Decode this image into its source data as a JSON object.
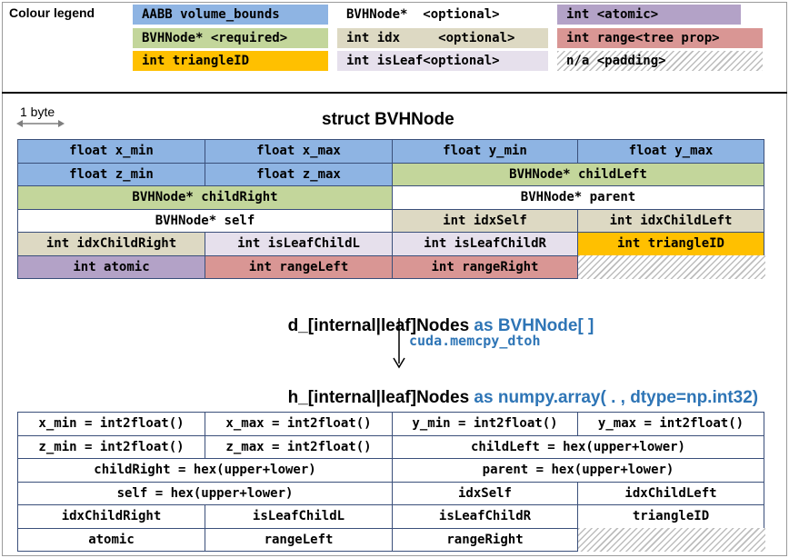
{
  "legend": {
    "title": "Colour legend",
    "items": [
      {
        "id": "aabb",
        "label": "AABB volume_bounds",
        "color": "#8eb4e3"
      },
      {
        "id": "bvh_opt",
        "label": "BVHNode*  <optional>",
        "color": "#ffffff"
      },
      {
        "id": "int_atomic",
        "label": "int <atomic>",
        "color": "#b3a2c7"
      },
      {
        "id": "bvh_req",
        "label": "BVHNode* <required>",
        "color": "#c3d69b"
      },
      {
        "id": "int_idx",
        "label": "int idx     <optional>",
        "color": "#ddd9c3"
      },
      {
        "id": "int_range",
        "label": "int range<tree prop>",
        "color": "#d99694"
      },
      {
        "id": "int_tri",
        "label": "int triangleID",
        "color": "#ffc000"
      },
      {
        "id": "int_isleaf",
        "label": "int isLeaf<optional>",
        "color": "#e6e0ec"
      },
      {
        "id": "na",
        "label": "n/a <padding>",
        "color": "hatch"
      }
    ]
  },
  "scale_label": "1 byte",
  "struct_title": "struct BVHNode",
  "device_label": {
    "prefix": "d_[internal|leaf]Nodes ",
    "suffix": "as BVHNode[ ]"
  },
  "memcpy_label": "cuda.memcpy_dtoh",
  "host_label": {
    "prefix": "h_[internal|leaf]Nodes ",
    "suffix": "as numpy.array( . , dtype=np.int32)"
  },
  "struct_cells": [
    {
      "text": "float x_min",
      "color": "#8eb4e3"
    },
    {
      "text": "float x_max",
      "color": "#8eb4e3"
    },
    {
      "text": "float y_min",
      "color": "#8eb4e3"
    },
    {
      "text": "float y_max",
      "color": "#8eb4e3"
    },
    {
      "text": "float z_min",
      "color": "#8eb4e3"
    },
    {
      "text": "float z_max",
      "color": "#8eb4e3"
    },
    {
      "text": "BVHNode* childLeft",
      "color": "#c3d69b"
    },
    {
      "text": "BVHNode* childRight",
      "color": "#c3d69b"
    },
    {
      "text": "BVHNode* parent",
      "color": "#ffffff"
    },
    {
      "text": "BVHNode* self",
      "color": "#ffffff"
    },
    {
      "text": "int idxSelf",
      "color": "#ddd9c3"
    },
    {
      "text": "int idxChildLeft",
      "color": "#ddd9c3"
    },
    {
      "text": "int idxChildRight",
      "color": "#ddd9c3"
    },
    {
      "text": "int isLeafChildL",
      "color": "#e6e0ec"
    },
    {
      "text": "int isLeafChildR",
      "color": "#e6e0ec"
    },
    {
      "text": "int triangleID",
      "color": "#ffc000"
    },
    {
      "text": "int atomic",
      "color": "#b3a2c7"
    },
    {
      "text": "int rangeLeft",
      "color": "#d99694"
    },
    {
      "text": "int rangeRight",
      "color": "#d99694"
    },
    {
      "text": "",
      "color": "hatch"
    }
  ],
  "host_cells": [
    {
      "text": "x_min = int2float()"
    },
    {
      "text": "x_max = int2float()"
    },
    {
      "text": "y_min = int2float()"
    },
    {
      "text": "y_max = int2float()"
    },
    {
      "text": "z_min = int2float()"
    },
    {
      "text": "z_max = int2float()"
    },
    {
      "text": "childLeft = hex(upper+lower)"
    },
    {
      "text": "childRight = hex(upper+lower)"
    },
    {
      "text": "parent = hex(upper+lower)"
    },
    {
      "text": "self = hex(upper+lower)"
    },
    {
      "text": "idxSelf"
    },
    {
      "text": "idxChildLeft"
    },
    {
      "text": "idxChildRight"
    },
    {
      "text": "isLeafChildL"
    },
    {
      "text": "isLeafChildR"
    },
    {
      "text": "triangleID"
    },
    {
      "text": "atomic"
    },
    {
      "text": "rangeLeft"
    },
    {
      "text": "rangeRight"
    },
    {
      "text": ""
    }
  ]
}
